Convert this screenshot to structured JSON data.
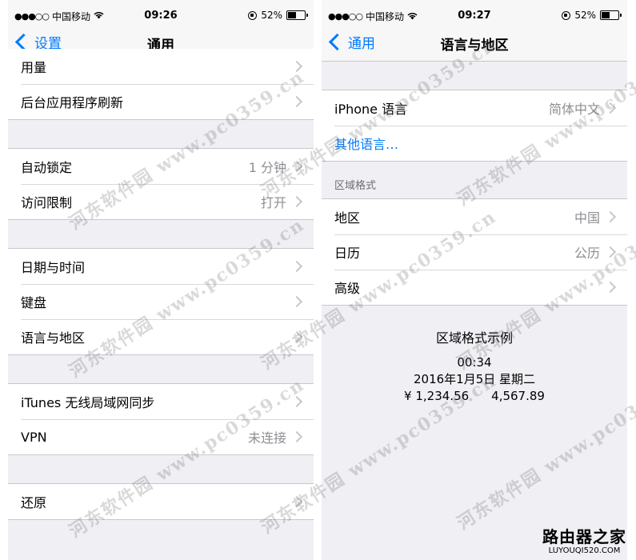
{
  "left": {
    "status": {
      "carrier": "中国移动",
      "time": "09:26",
      "battery": "52%",
      "battery_level": 0.52
    },
    "nav": {
      "back": "设置",
      "title": "通用"
    },
    "groups": [
      [
        {
          "label": "用量"
        },
        {
          "label": "后台应用程序刷新"
        }
      ],
      [
        {
          "label": "自动锁定",
          "value": "1 分钟"
        },
        {
          "label": "访问限制",
          "value": "打开"
        }
      ],
      [
        {
          "label": "日期与时间"
        },
        {
          "label": "键盘"
        },
        {
          "label": "语言与地区"
        }
      ],
      [
        {
          "label": "iTunes 无线局域网同步"
        },
        {
          "label": "VPN",
          "value": "未连接"
        }
      ],
      [
        {
          "label": "还原"
        }
      ]
    ]
  },
  "right": {
    "status": {
      "carrier": "中国移动",
      "time": "09:27",
      "battery": "52%",
      "battery_level": 0.52
    },
    "nav": {
      "back": "通用",
      "title": "语言与地区"
    },
    "language_group": [
      {
        "label": "iPhone 语言",
        "value": "简体中文"
      },
      {
        "label": "其他语言…"
      }
    ],
    "region_header": "区域格式",
    "region_group": [
      {
        "label": "地区",
        "value": "中国"
      },
      {
        "label": "日历",
        "value": "公历"
      },
      {
        "label": "高级"
      }
    ],
    "example": {
      "title": "区域格式示例",
      "time": "00:34",
      "date": "2016年1月5日 星期二",
      "currency": "¥ 1,234.56",
      "number": "4,567.89"
    }
  },
  "watermark": "河东软件园 www.pc0359.cn",
  "logo": {
    "cn": "路由器之家",
    "en": "LUYOUQI520.COM"
  }
}
